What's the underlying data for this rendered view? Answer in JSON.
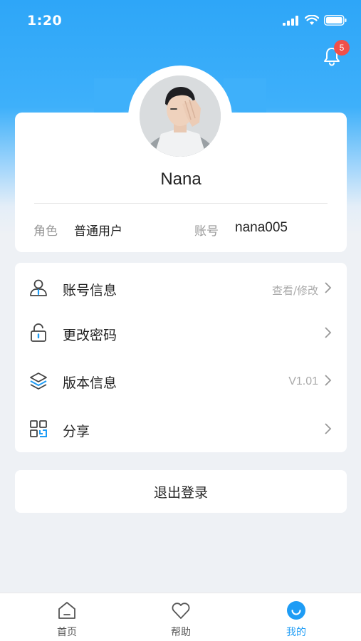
{
  "status_bar": {
    "time": "1:20"
  },
  "notifications": {
    "badge_count": "5"
  },
  "profile": {
    "name": "Nana",
    "role_label": "角色",
    "role_value": "普通用户",
    "account_label": "账号",
    "account_value": "nana005"
  },
  "menu": {
    "items": [
      {
        "label": "账号信息",
        "extra": "查看/修改",
        "icon": "user-icon"
      },
      {
        "label": "更改密码",
        "extra": "",
        "icon": "unlock-icon"
      },
      {
        "label": "版本信息",
        "extra": "V1.01",
        "icon": "layers-icon"
      },
      {
        "label": "分享",
        "extra": "",
        "icon": "qr-code-icon"
      }
    ]
  },
  "logout": {
    "label": "退出登录"
  },
  "tabs": [
    {
      "label": "首页",
      "icon": "home-icon"
    },
    {
      "label": "帮助",
      "icon": "heart-icon"
    },
    {
      "label": "我的",
      "icon": "smile-icon",
      "active": true
    }
  ],
  "colors": {
    "primary": "#2ea6f8",
    "active_tab": "#1e9cf5",
    "badge": "#f0504a",
    "background": "#eef1f5"
  }
}
